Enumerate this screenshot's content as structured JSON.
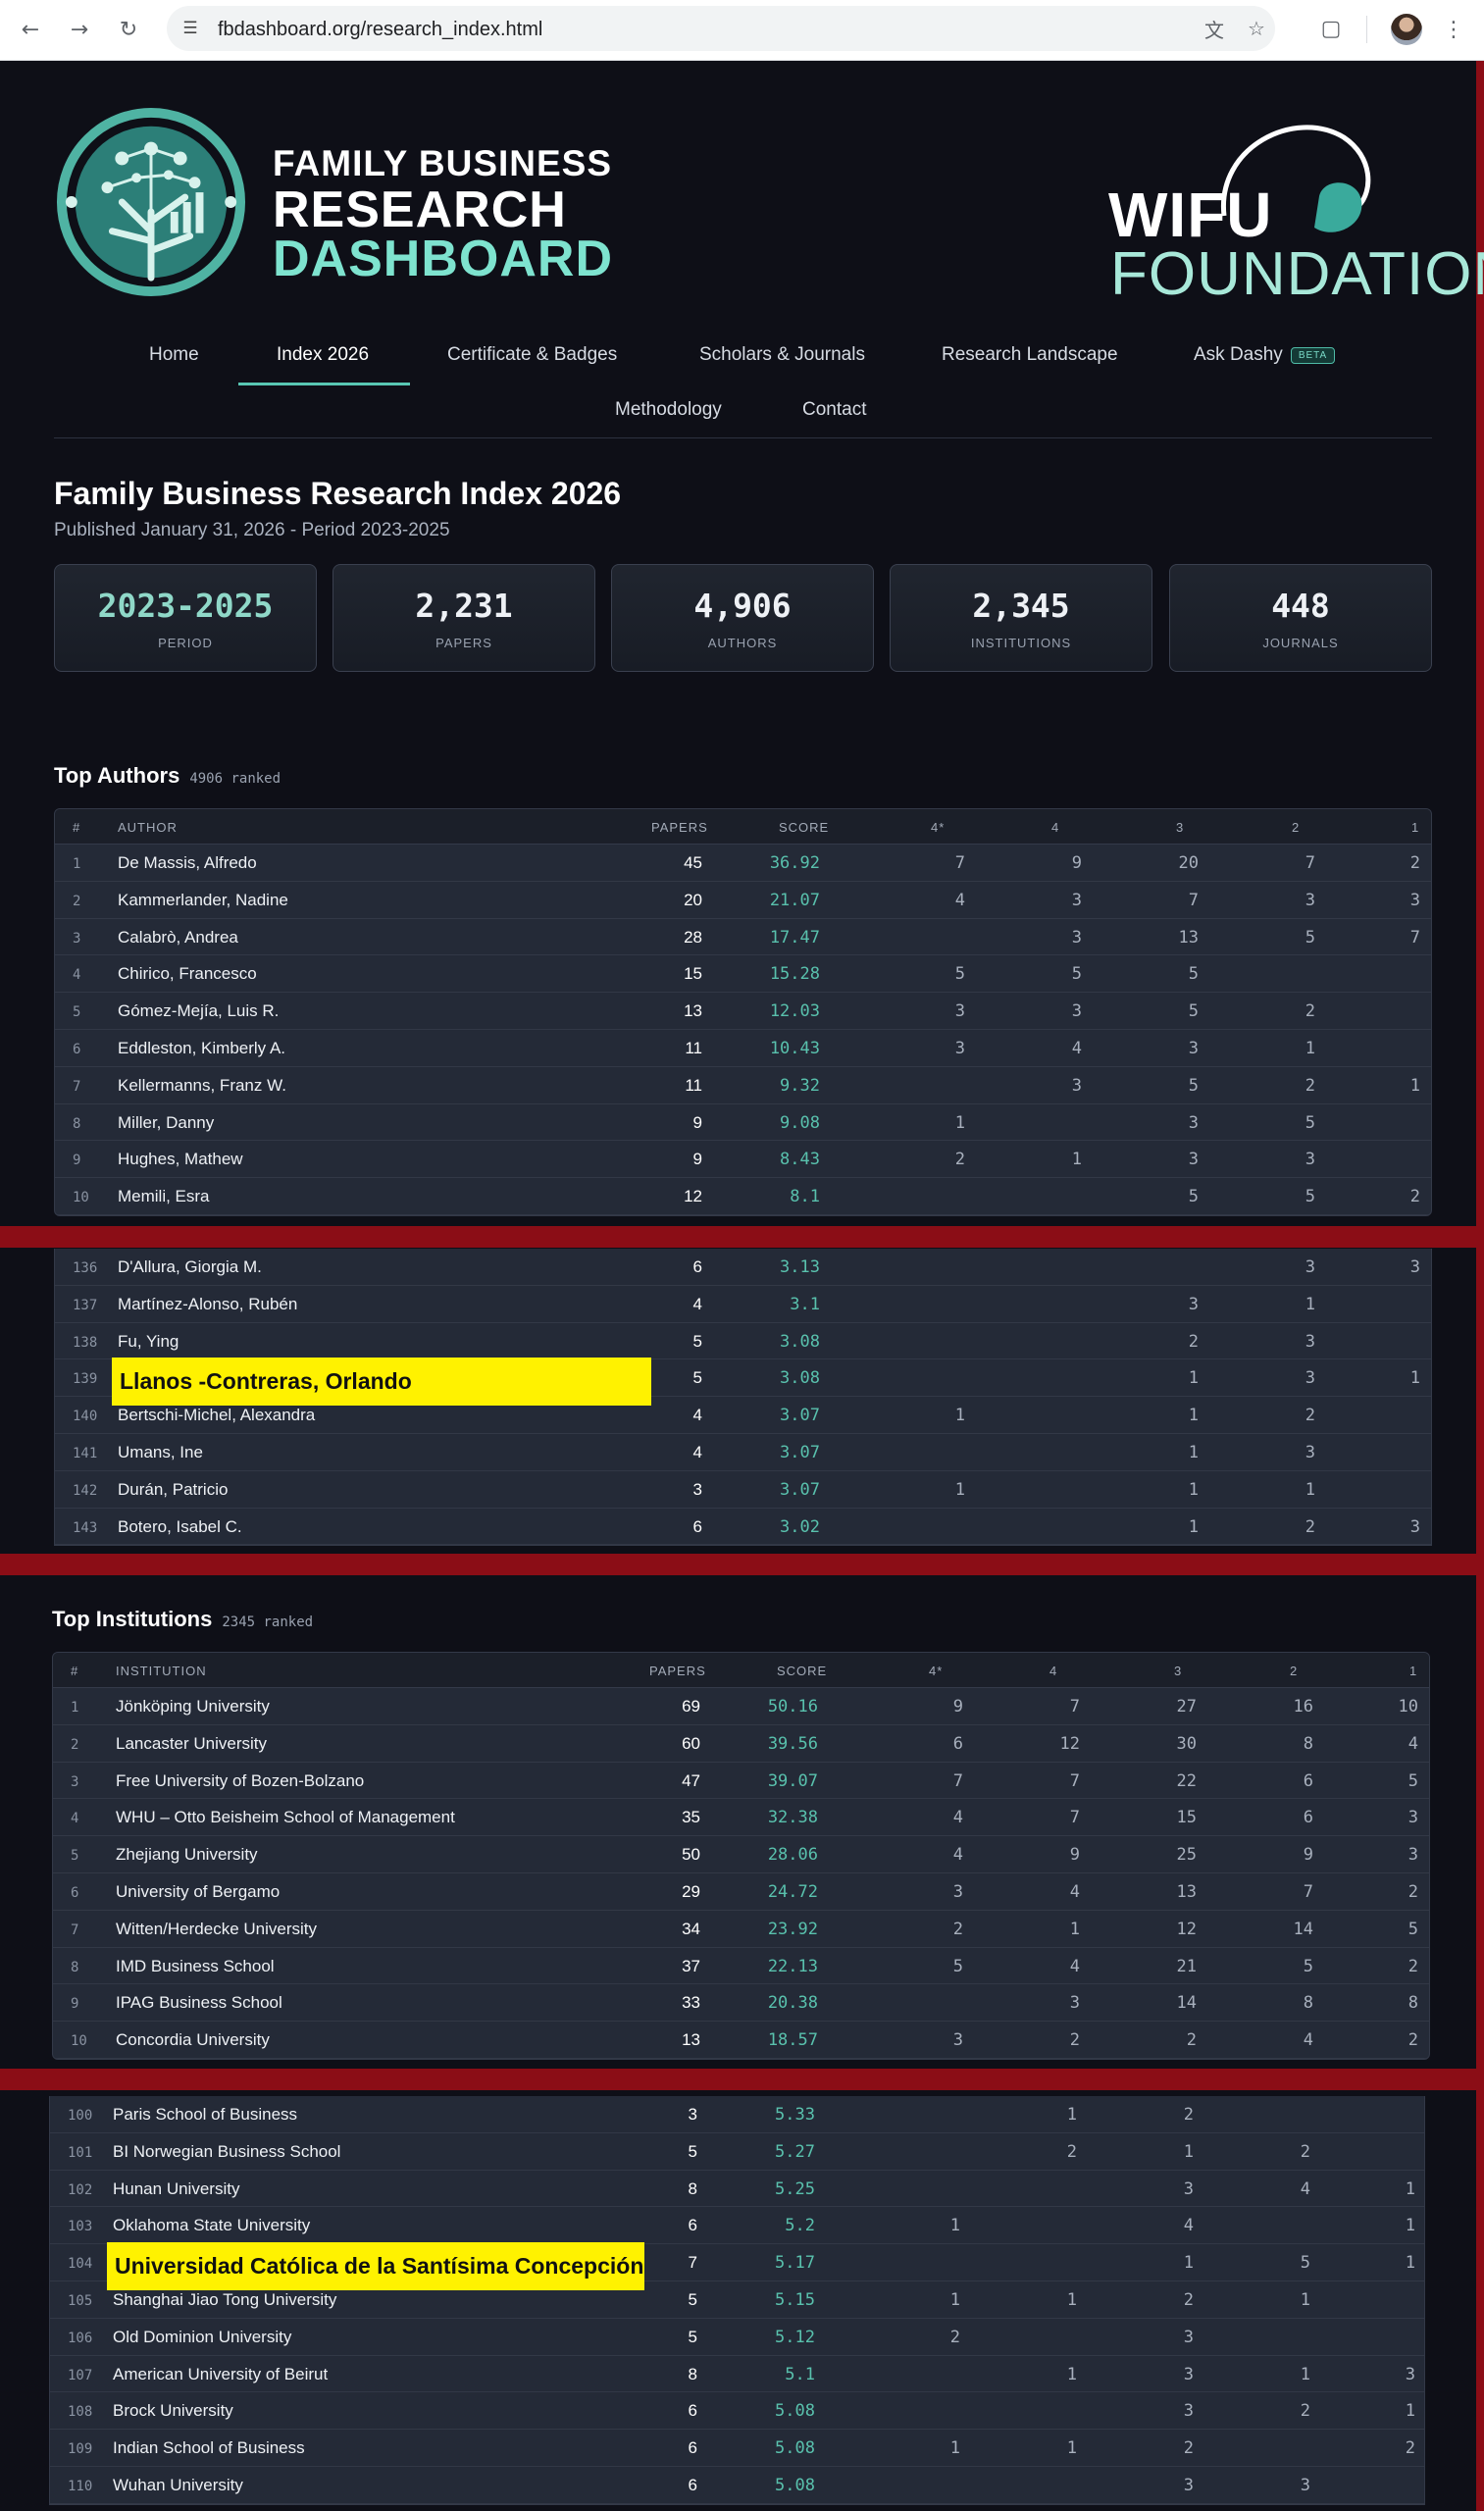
{
  "browser": {
    "url": "fbdashboard.org/research_index.html"
  },
  "header": {
    "logo_line1": "FAMILY BUSINESS",
    "logo_line2": "RESEARCH",
    "logo_line3": "DASHBOARD",
    "partner_top": "WIFU",
    "partner_bottom": "FOUNDATION"
  },
  "nav": {
    "items": [
      "Home",
      "Index 2026",
      "Certificate & Badges",
      "Scholars & Journals",
      "Research Landscape",
      "Ask Dashy",
      "Methodology",
      "Contact"
    ],
    "beta": "BETA",
    "active": "Index 2026"
  },
  "page": {
    "title": "Family Business Research Index 2026",
    "subtitle": "Published January 31, 2026 - Period 2023-2025"
  },
  "stats": [
    {
      "value": "2023-2025",
      "label": "PERIOD"
    },
    {
      "value": "2,231",
      "label": "PAPERS"
    },
    {
      "value": "4,906",
      "label": "AUTHORS"
    },
    {
      "value": "2,345",
      "label": "INSTITUTIONS"
    },
    {
      "value": "448",
      "label": "JOURNALS"
    }
  ],
  "authors": {
    "title": "Top Authors",
    "count": "4906 ranked",
    "headers": [
      "#",
      "AUTHOR",
      "PAPERS",
      "SCORE",
      "4*",
      "4",
      "3",
      "2",
      "1"
    ],
    "top": [
      [
        "1",
        "De Massis, Alfredo",
        "45",
        "36.92",
        "7",
        "9",
        "20",
        "7",
        "2"
      ],
      [
        "2",
        "Kammerlander, Nadine",
        "20",
        "21.07",
        "4",
        "3",
        "7",
        "3",
        "3"
      ],
      [
        "3",
        "Calabrò, Andrea",
        "28",
        "17.47",
        "",
        "3",
        "13",
        "5",
        "7"
      ],
      [
        "4",
        "Chirico, Francesco",
        "15",
        "15.28",
        "5",
        "5",
        "5",
        "",
        ""
      ],
      [
        "5",
        "Gómez-Mejía, Luis R.",
        "13",
        "12.03",
        "3",
        "3",
        "5",
        "2",
        ""
      ],
      [
        "6",
        "Eddleston, Kimberly A.",
        "11",
        "10.43",
        "3",
        "4",
        "3",
        "1",
        ""
      ],
      [
        "7",
        "Kellermanns, Franz W.",
        "11",
        "9.32",
        "",
        "3",
        "5",
        "2",
        "1"
      ],
      [
        "8",
        "Miller, Danny",
        "9",
        "9.08",
        "1",
        "",
        "3",
        "5",
        ""
      ],
      [
        "9",
        "Hughes, Mathew",
        "9",
        "8.43",
        "2",
        "1",
        "3",
        "3",
        ""
      ],
      [
        "10",
        "Memili, Esra",
        "12",
        "8.1",
        "",
        "",
        "5",
        "5",
        "2"
      ]
    ],
    "excerpt": [
      [
        "136",
        "D'Allura, Giorgia M.",
        "6",
        "3.13",
        "",
        "",
        "",
        "3",
        "3"
      ],
      [
        "137",
        "Martínez-Alonso, Rubén",
        "4",
        "3.1",
        "",
        "",
        "3",
        "1",
        ""
      ],
      [
        "138",
        "Fu, Ying",
        "5",
        "3.08",
        "",
        "",
        "2",
        "3",
        ""
      ],
      [
        "139",
        "Llanos -Contreras, Orlando",
        "5",
        "3.08",
        "",
        "",
        "1",
        "3",
        "1"
      ],
      [
        "140",
        "Bertschi-Michel, Alexandra",
        "4",
        "3.07",
        "1",
        "",
        "1",
        "2",
        ""
      ],
      [
        "141",
        "Umans, Ine",
        "4",
        "3.07",
        "",
        "",
        "1",
        "3",
        ""
      ],
      [
        "142",
        "Durán, Patricio",
        "3",
        "3.07",
        "1",
        "",
        "1",
        "1",
        ""
      ],
      [
        "143",
        "Botero, Isabel C.",
        "6",
        "3.02",
        "",
        "",
        "1",
        "2",
        "3"
      ]
    ],
    "highlight_index": 3
  },
  "institutions": {
    "title": "Top Institutions",
    "count": "2345 ranked",
    "headers": [
      "#",
      "INSTITUTION",
      "PAPERS",
      "SCORE",
      "4*",
      "4",
      "3",
      "2",
      "1"
    ],
    "top": [
      [
        "1",
        "Jönköping University",
        "69",
        "50.16",
        "9",
        "7",
        "27",
        "16",
        "10"
      ],
      [
        "2",
        "Lancaster University",
        "60",
        "39.56",
        "6",
        "12",
        "30",
        "8",
        "4"
      ],
      [
        "3",
        "Free University of Bozen-Bolzano",
        "47",
        "39.07",
        "7",
        "7",
        "22",
        "6",
        "5"
      ],
      [
        "4",
        "WHU – Otto Beisheim School of Management",
        "35",
        "32.38",
        "4",
        "7",
        "15",
        "6",
        "3"
      ],
      [
        "5",
        "Zhejiang University",
        "50",
        "28.06",
        "4",
        "9",
        "25",
        "9",
        "3"
      ],
      [
        "6",
        "University of Bergamo",
        "29",
        "24.72",
        "3",
        "4",
        "13",
        "7",
        "2"
      ],
      [
        "7",
        "Witten/Herdecke University",
        "34",
        "23.92",
        "2",
        "1",
        "12",
        "14",
        "5"
      ],
      [
        "8",
        "IMD Business School",
        "37",
        "22.13",
        "5",
        "4",
        "21",
        "5",
        "2"
      ],
      [
        "9",
        "IPAG Business School",
        "33",
        "20.38",
        "",
        "3",
        "14",
        "8",
        "8"
      ],
      [
        "10",
        "Concordia University",
        "13",
        "18.57",
        "3",
        "2",
        "2",
        "4",
        "2"
      ]
    ],
    "excerpt": [
      [
        "100",
        "Paris School of Business",
        "3",
        "5.33",
        "",
        "1",
        "2",
        "",
        ""
      ],
      [
        "101",
        "BI Norwegian Business School",
        "5",
        "5.27",
        "",
        "2",
        "1",
        "2",
        ""
      ],
      [
        "102",
        "Hunan University",
        "8",
        "5.25",
        "",
        "",
        "3",
        "4",
        "1"
      ],
      [
        "103",
        "Oklahoma State University",
        "6",
        "5.2",
        "1",
        "",
        "4",
        "",
        "1"
      ],
      [
        "104",
        "Universidad Católica de la Santísima Concepción",
        "7",
        "5.17",
        "",
        "",
        "1",
        "5",
        "1"
      ],
      [
        "105",
        "Shanghai Jiao Tong University",
        "5",
        "5.15",
        "1",
        "1",
        "2",
        "1",
        ""
      ],
      [
        "106",
        "Old Dominion University",
        "5",
        "5.12",
        "2",
        "",
        "3",
        "",
        ""
      ],
      [
        "107",
        "American University of Beirut",
        "8",
        "5.1",
        "",
        "1",
        "3",
        "1",
        "3"
      ],
      [
        "108",
        "Brock University",
        "6",
        "5.08",
        "",
        "",
        "3",
        "2",
        "1"
      ],
      [
        "109",
        "Indian School of Business",
        "6",
        "5.08",
        "1",
        "1",
        "2",
        "",
        "2"
      ],
      [
        "110",
        "Wuhan University",
        "6",
        "5.08",
        "",
        "",
        "3",
        "3",
        ""
      ]
    ],
    "highlight_index": 4
  },
  "colors": {
    "accent": "#59c1ad",
    "highlight": "#fff200",
    "divider": "#8b0d16",
    "background": "#0e0f17"
  }
}
